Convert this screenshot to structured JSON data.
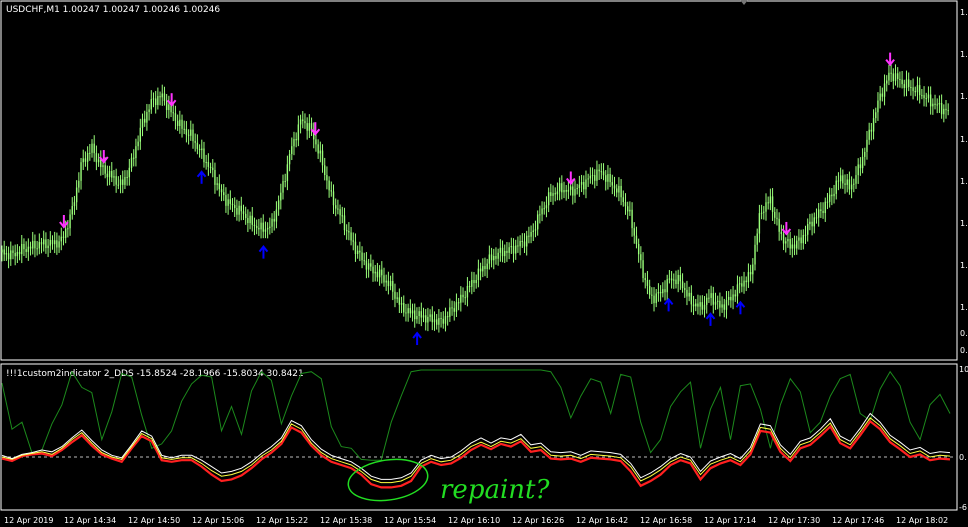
{
  "main_chart": {
    "header": "USDCHF,M1  1.00247 1.00247 1.00246 1.00246",
    "price_axis_labels": [
      "1.",
      "1.",
      "1.",
      "1.",
      "1.",
      "1.",
      "1.",
      "1.",
      "0.",
      "0."
    ],
    "colors": {
      "bg": "#000000",
      "candle": "#9aff7a",
      "frame": "#ffffff",
      "up_arrow": "#0000ff",
      "down_arrow": "#ff33ff"
    }
  },
  "indicator": {
    "header": "!!!1custom2indicator 2_DDS -15.8524 -28.1966 -15.8034 30.8421",
    "axis_labels": [
      "10",
      "0.",
      "-6"
    ],
    "annotation": "repaint?",
    "colors": {
      "red": "#ff2020",
      "yellow": "#ffff40",
      "white": "#ffffff",
      "green": "#1c8a1c",
      "zero": "#bbbbbb"
    }
  },
  "time_axis_labels": [
    "12 Apr 2019",
    "12 Apr 14:34",
    "12 Apr 14:50",
    "12 Apr 15:06",
    "12 Apr 15:22",
    "12 Apr 15:38",
    "12 Apr 15:54",
    "12 Apr 16:10",
    "12 Apr 16:26",
    "12 Apr 16:42",
    "12 Apr 16:58",
    "12 Apr 17:14",
    "12 Apr 17:30",
    "12 Apr 17:46",
    "12 Apr 18:02"
  ],
  "chart_data": [
    {
      "type": "line",
      "title": "USDCHF,M1  1.00247 1.00247 1.00246 1.00246",
      "x": [
        0,
        10,
        20,
        30,
        40,
        50,
        60,
        70,
        80,
        90,
        100,
        110,
        120,
        130,
        140,
        150,
        160,
        170,
        180,
        190,
        200,
        210,
        220,
        230,
        240,
        250,
        260,
        270,
        280,
        290,
        300,
        310,
        320,
        330,
        340,
        350,
        360,
        370,
        380,
        390,
        400,
        410,
        420,
        430,
        440,
        450,
        460,
        470,
        480,
        490,
        500,
        510,
        520,
        530,
        540,
        550,
        560,
        570,
        580,
        590,
        600,
        610,
        620,
        630,
        640,
        650,
        660,
        670,
        680,
        690,
        700,
        710,
        720,
        730,
        740,
        750,
        760,
        770,
        780,
        790,
        800,
        810,
        820,
        830,
        840,
        850,
        860,
        870,
        880,
        890,
        900,
        910,
        920,
        930,
        940,
        950
      ],
      "values": [
        0.24,
        0.23,
        0.25,
        0.26,
        0.27,
        0.27,
        0.28,
        0.38,
        0.55,
        0.6,
        0.53,
        0.5,
        0.47,
        0.55,
        0.68,
        0.76,
        0.78,
        0.72,
        0.67,
        0.64,
        0.58,
        0.52,
        0.44,
        0.4,
        0.38,
        0.34,
        0.32,
        0.33,
        0.45,
        0.6,
        0.7,
        0.66,
        0.56,
        0.43,
        0.36,
        0.28,
        0.22,
        0.18,
        0.16,
        0.12,
        0.05,
        0.03,
        0.02,
        0.01,
        0.0,
        0.04,
        0.08,
        0.13,
        0.18,
        0.22,
        0.24,
        0.25,
        0.27,
        0.3,
        0.38,
        0.44,
        0.46,
        0.45,
        0.47,
        0.5,
        0.52,
        0.48,
        0.44,
        0.36,
        0.2,
        0.08,
        0.1,
        0.15,
        0.14,
        0.07,
        0.05,
        0.09,
        0.05,
        0.08,
        0.13,
        0.16,
        0.38,
        0.42,
        0.3,
        0.26,
        0.28,
        0.34,
        0.38,
        0.43,
        0.5,
        0.46,
        0.54,
        0.66,
        0.78,
        0.86,
        0.83,
        0.81,
        0.79,
        0.76,
        0.74,
        0.72
      ],
      "markers": {
        "down_x": [
          62,
          102,
          170,
          314,
          570,
          786,
          890
        ],
        "up_x": [
          200,
          262,
          416,
          668,
          710,
          740
        ]
      }
    },
    {
      "type": "line",
      "title": "!!!1custom2indicator 2_DDS -15.8524 -28.1966 -15.8034 30.8421",
      "x": [
        0,
        10,
        20,
        30,
        40,
        50,
        60,
        70,
        80,
        90,
        100,
        110,
        120,
        130,
        140,
        150,
        160,
        170,
        180,
        190,
        200,
        210,
        220,
        230,
        240,
        250,
        260,
        270,
        280,
        290,
        300,
        310,
        320,
        330,
        340,
        350,
        360,
        370,
        380,
        390,
        400,
        410,
        420,
        430,
        440,
        450,
        460,
        470,
        480,
        490,
        500,
        510,
        520,
        530,
        540,
        550,
        560,
        570,
        580,
        590,
        600,
        610,
        620,
        630,
        640,
        650,
        660,
        670,
        680,
        690,
        700,
        710,
        720,
        730,
        740,
        750,
        760,
        770,
        780,
        790,
        800,
        810,
        820,
        830,
        840,
        850,
        860,
        870,
        880,
        890,
        900,
        910,
        920,
        930,
        940,
        950
      ],
      "series": [
        {
          "values": [
            -2,
            -5,
            1,
            3,
            4,
            1,
            8,
            17,
            25,
            13,
            3,
            -2,
            -6,
            10,
            24,
            18,
            -4,
            -6,
            -4,
            -4,
            -12,
            -22,
            -30,
            -28,
            -23,
            -14,
            -3,
            5,
            15,
            34,
            28,
            13,
            2,
            -6,
            -10,
            -14,
            -22,
            -34,
            -38,
            -38,
            -36,
            -30,
            -12,
            -6,
            -10,
            -8,
            -1,
            8,
            14,
            9,
            15,
            12,
            18,
            6,
            8,
            -2,
            -3,
            -2,
            -6,
            -1,
            -2,
            -3,
            -5,
            -18,
            -36,
            -30,
            -22,
            -10,
            -4,
            -8,
            -28,
            -14,
            -8,
            -4,
            -10,
            3,
            30,
            28,
            6,
            -5,
            10,
            14,
            24,
            35,
            16,
            10,
            25,
            41,
            32,
            17,
            9,
            0,
            3,
            -4,
            -2,
            -3
          ]
        },
        {
          "values": [
            0,
            -3,
            2,
            4,
            6,
            3,
            10,
            20,
            28,
            16,
            5,
            0,
            -3,
            12,
            27,
            21,
            -1,
            -3,
            -1,
            -1,
            -8,
            -17,
            -24,
            -22,
            -18,
            -10,
            1,
            8,
            18,
            38,
            32,
            16,
            5,
            -2,
            -6,
            -10,
            -18,
            -28,
            -32,
            -32,
            -30,
            -24,
            -8,
            -2,
            -6,
            -4,
            3,
            12,
            17,
            12,
            18,
            16,
            21,
            10,
            12,
            2,
            1,
            2,
            -2,
            3,
            2,
            1,
            -1,
            -12,
            -30,
            -24,
            -16,
            -6,
            0,
            -4,
            -22,
            -9,
            -4,
            0,
            -6,
            7,
            34,
            32,
            10,
            -1,
            14,
            18,
            28,
            39,
            20,
            14,
            29,
            45,
            36,
            21,
            13,
            4,
            7,
            0,
            2,
            1
          ]
        },
        {
          "values": [
            2,
            -2,
            3,
            5,
            8,
            6,
            12,
            22,
            31,
            19,
            8,
            2,
            -1,
            14,
            30,
            24,
            2,
            -1,
            2,
            2,
            -4,
            -12,
            -20,
            -18,
            -14,
            -6,
            4,
            12,
            22,
            42,
            36,
            20,
            9,
            2,
            -2,
            -6,
            -14,
            -24,
            -28,
            -28,
            -26,
            -20,
            -4,
            2,
            -2,
            0,
            7,
            16,
            22,
            16,
            22,
            20,
            26,
            14,
            16,
            6,
            5,
            6,
            2,
            7,
            6,
            5,
            3,
            -8,
            -26,
            -20,
            -12,
            -2,
            4,
            0,
            -18,
            -5,
            0,
            4,
            -2,
            11,
            38,
            36,
            14,
            3,
            18,
            22,
            32,
            44,
            24,
            18,
            33,
            50,
            40,
            25,
            17,
            8,
            11,
            4,
            6,
            5
          ]
        },
        {
          "values": [
            85,
            32,
            40,
            5,
            8,
            38,
            60,
            98,
            80,
            74,
            20,
            52,
            96,
            92,
            48,
            10,
            15,
            30,
            64,
            84,
            94,
            92,
            30,
            58,
            26,
            76,
            98,
            88,
            38,
            70,
            96,
            98,
            90,
            35,
            12,
            10,
            -3,
            -4,
            -4,
            40,
            70,
            98,
            100,
            100,
            100,
            100,
            100,
            100,
            100,
            100,
            100,
            100,
            100,
            100,
            100,
            98,
            80,
            45,
            70,
            90,
            86,
            50,
            95,
            92,
            40,
            5,
            20,
            58,
            75,
            86,
            10,
            55,
            80,
            20,
            82,
            84,
            55,
            10,
            60,
            90,
            75,
            28,
            40,
            70,
            90,
            95,
            50,
            42,
            78,
            98,
            82,
            40,
            20,
            60,
            72,
            50
          ]
        }
      ],
      "ylim": [
        -60,
        100
      ]
    }
  ]
}
